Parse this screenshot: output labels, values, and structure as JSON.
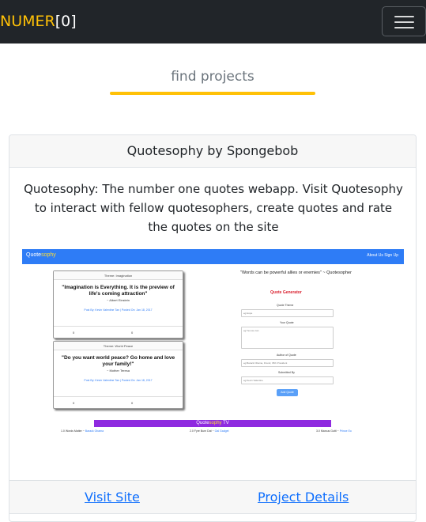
{
  "navbar": {
    "brand_name": "NUMER",
    "brand_suffix": "[0]",
    "toggle_icon": "hamburger-icon"
  },
  "find_projects": {
    "label": "find projects",
    "accent": "#ffc107"
  },
  "project": {
    "title": "Quotesophy by Spongebob",
    "description": "Quotesophy: The number one quotes webapp. Visit Quotesophy to interact with fellow quotesophers, create quotes and rate the quotes on the site",
    "visit_label": "Visit Site",
    "details_label": "Project Details",
    "link_color": "#0d6efd"
  },
  "preview": {
    "brand_a": "Quote",
    "brand_b": "sophy",
    "nav_links": "About Us   Sign Up",
    "cards": [
      {
        "theme": "Theme: Imagination",
        "quote": "\"Imagination is Everything. It is the preview of life's coming attraction\"",
        "author": "~ Albert Einstein",
        "posted": "Post By: Kevin Valentine Tan  |  Posted On: Jan 18, 2017",
        "left": "0",
        "mid": "0"
      },
      {
        "theme": "Theme: World Peace",
        "quote": "\"Do you want world peace? Go home and love your family!\"",
        "author": "~ Mother Teresa",
        "posted": "Post By: Kevin Valentine Tan  |  Posted On: Jan 18, 2017",
        "left": "0",
        "mid": "0"
      }
    ],
    "side_quote": "\"Words can be powerful allies or enemies\" ~ Quotesopher",
    "generator_title": "Quote Generator",
    "form": {
      "theme_label": "Quote Theme",
      "theme_placeholder": "eg:Hope",
      "quote_label": "Your Quote",
      "quote_placeholder": "eg:Yes we can",
      "author_label": "Author of Quote",
      "author_placeholder": "eg:Barack Obama, Friend, 35th President",
      "submitter_label": "Submitted By",
      "submitter_placeholder": "eg:Kevin Valentine",
      "button": "Add Quote"
    },
    "tv_a": "Quote",
    "tv_b": "sophy",
    "tv_c": " TV",
    "footer": [
      {
        "rank": "1.0 Words Matter ~",
        "name": "Barack Obama"
      },
      {
        "rank": "2.0 Fyre Burn Dat ~",
        "name": "Gal Gadget"
      },
      {
        "rank": "3.0 Marcus Gutti ~",
        "name": "Prince Eo"
      }
    ]
  }
}
